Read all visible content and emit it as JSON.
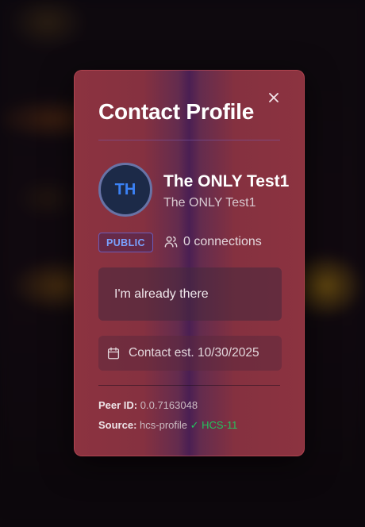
{
  "modal": {
    "title": "Contact Profile",
    "avatar_initials": "TH",
    "display_name": "The ONLY Test1",
    "alias": "The ONLY Test1",
    "visibility_badge": "PUBLIC",
    "connections_text": "0 connections",
    "bio": "I'm already there",
    "contact_established": "Contact est. 10/30/2025",
    "peer_id_label": "Peer ID:",
    "peer_id_value": "0.0.7163048",
    "source_label": "Source:",
    "source_value": "hcs-profile",
    "source_standard": "✓ HCS-11"
  },
  "icons": {
    "close": "close-icon",
    "connections": "users-icon",
    "calendar": "calendar-icon"
  },
  "colors": {
    "badge_text": "#7aa2ff",
    "avatar_text": "#3b82f6",
    "verified": "#22c55e"
  }
}
